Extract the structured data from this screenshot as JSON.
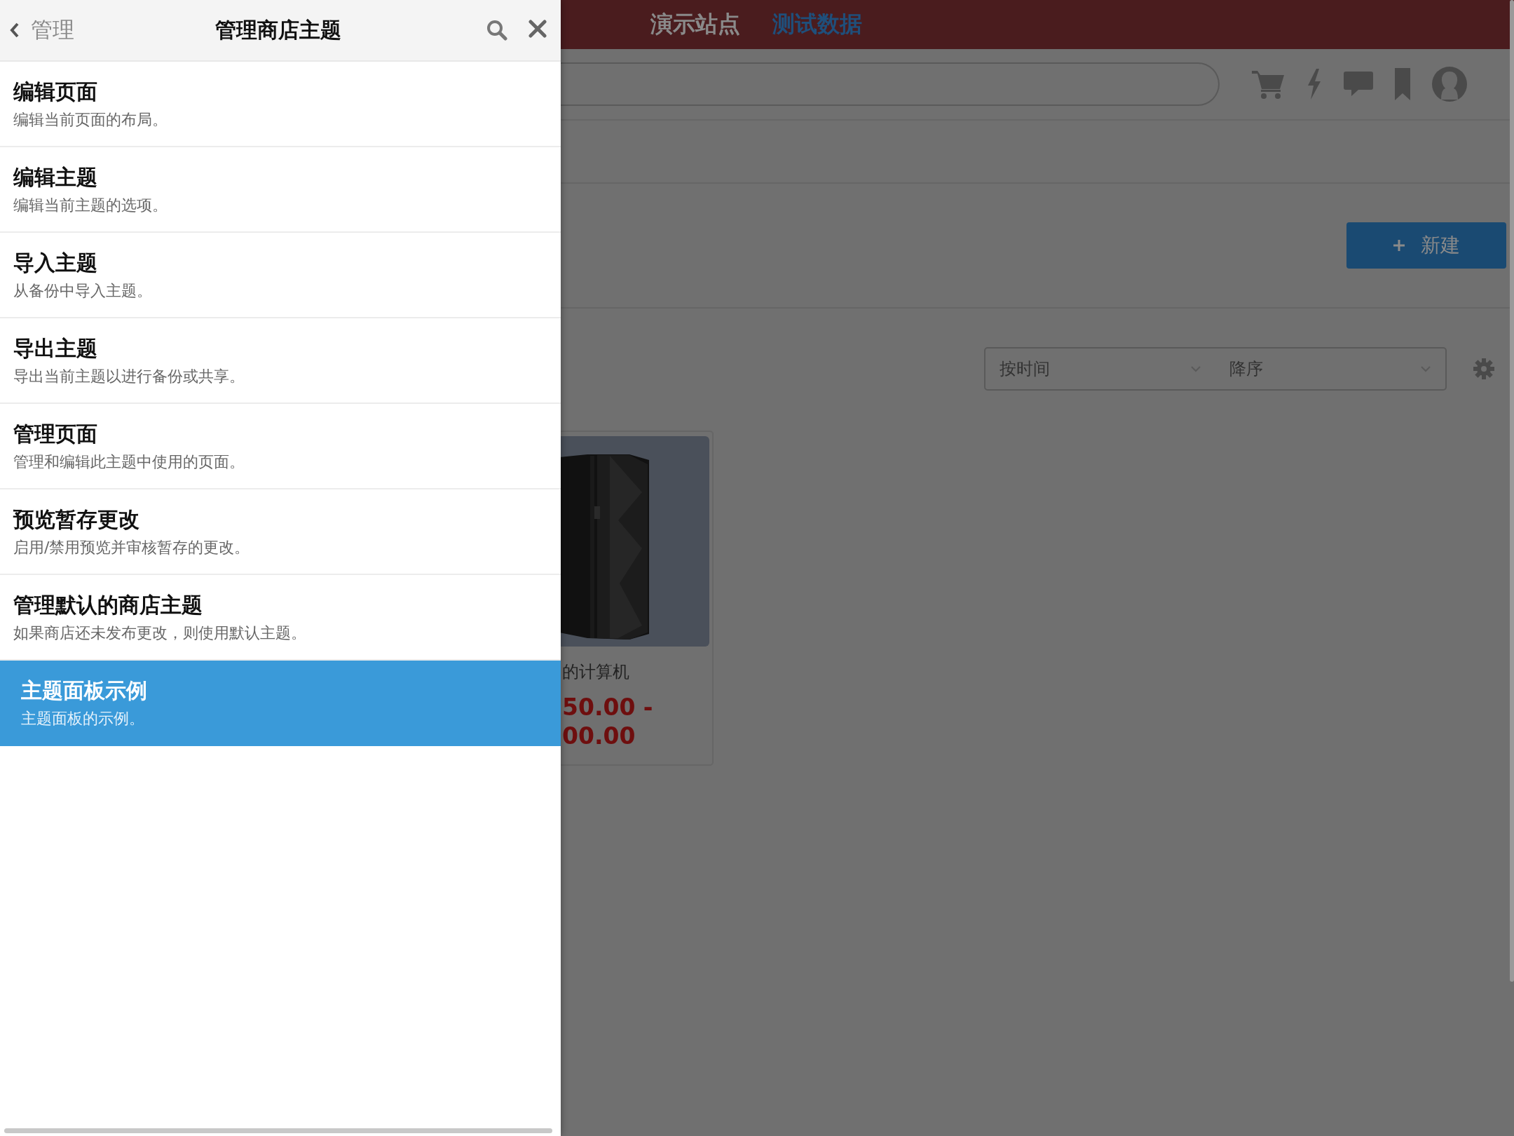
{
  "panel": {
    "back_label": "管理",
    "title": "管理商店主题",
    "items": [
      {
        "title": "编辑页面",
        "description": "编辑当前页面的布局。",
        "selected": false
      },
      {
        "title": "编辑主题",
        "description": "编辑当前主题的选项。",
        "selected": false
      },
      {
        "title": "导入主题",
        "description": "从备份中导入主题。",
        "selected": false
      },
      {
        "title": "导出主题",
        "description": "导出当前主题以进行备份或共享。",
        "selected": false
      },
      {
        "title": "管理页面",
        "description": "管理和编辑此主题中使用的页面。",
        "selected": false
      },
      {
        "title": "预览暂存更改",
        "description": "启用/禁用预览并审核暂存的更改。",
        "selected": false
      },
      {
        "title": "管理默认的商店主题",
        "description": "如果商店还未发布更改，则使用默认主题。",
        "selected": false
      },
      {
        "title": "主题面板示例",
        "description": "主题面板的示例。",
        "selected": true
      }
    ]
  },
  "site": {
    "top_links": [
      {
        "label": "演示站点",
        "selected": false
      },
      {
        "label": "测试数据",
        "selected": true
      }
    ],
    "new_button": "新建",
    "sort_by": "按时间",
    "sort_order": "降序",
    "product": {
      "kind": "picture",
      "name": "的计算机",
      "price_lines": [
        "50.00 -",
        "00.00"
      ]
    }
  }
}
